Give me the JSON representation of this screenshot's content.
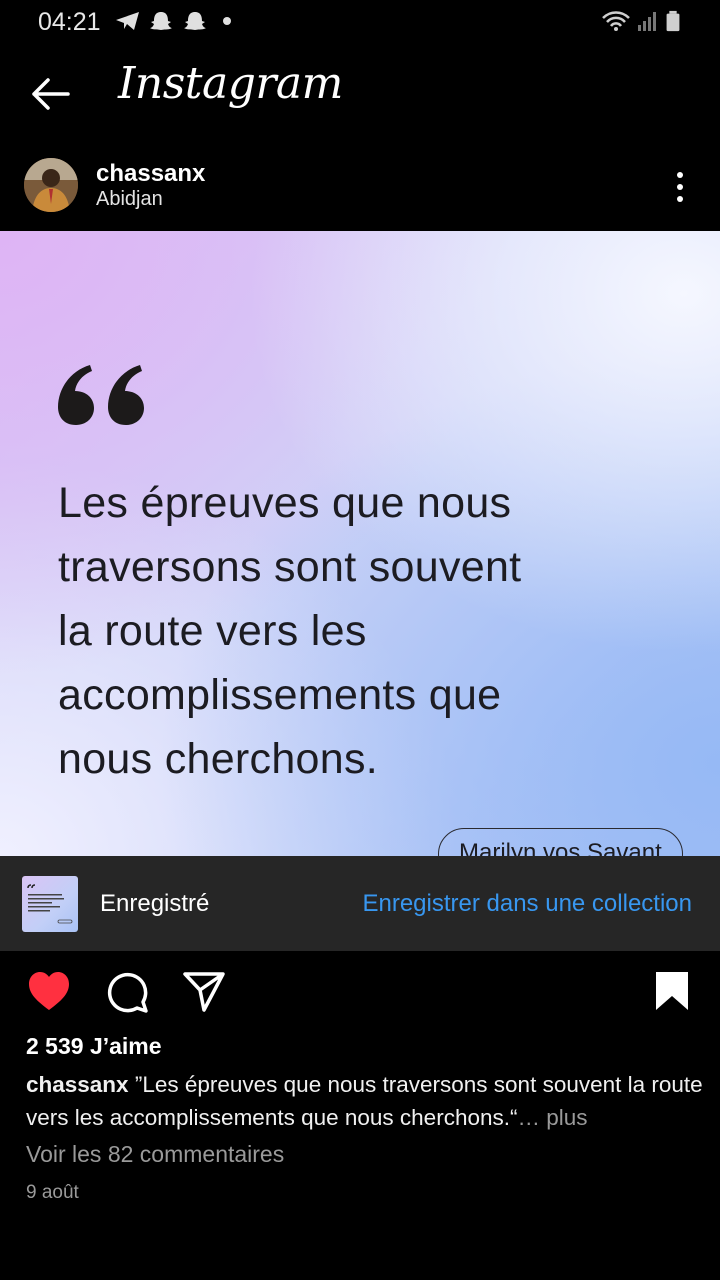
{
  "status_bar": {
    "time": "04:21",
    "icons": [
      "telegram-icon",
      "snapchat-icon",
      "snapchat-icon",
      "dot-icon",
      "wifi-icon",
      "signal-icon",
      "battery-icon"
    ]
  },
  "header": {
    "brand": "Instagram",
    "back_icon": "arrow-left-icon"
  },
  "post": {
    "username": "chassanx",
    "location": "Abidjan",
    "more_icon": "more-vertical-icon",
    "image": {
      "quote_lines": [
        "Les épreuves que nous",
        "traversons sont souvent",
        "la route vers les",
        "accomplissements que",
        "nous cherchons."
      ],
      "author": "Marilyn vos Savant"
    }
  },
  "saved_bar": {
    "label": "Enregistré",
    "action": "Enregistrer dans une collection"
  },
  "actions": {
    "liked": true,
    "like_color": "#ff3040",
    "link_color": "#3897f0"
  },
  "likes": "2 539 J’aime",
  "caption": {
    "user": "chassanx",
    "text": " ”Les épreuves que nous traversons sont souvent la route vers les accomplissements que nous cherchons.“",
    "more": "… plus"
  },
  "comments_link": "Voir les 82 commentaires",
  "date": "9 août"
}
